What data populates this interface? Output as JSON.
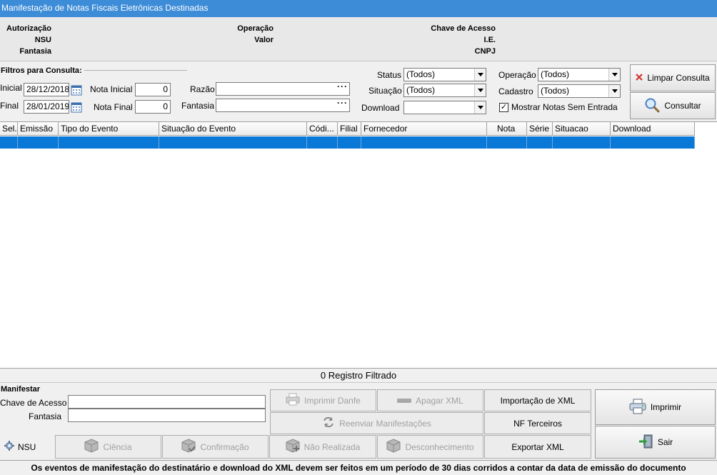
{
  "window": {
    "title": "Manifestação de Notas Fiscais Eletrônicas Destinadas"
  },
  "info": {
    "autorizacao": "Autorização",
    "nsu": "NSU",
    "fantasia": "Fantasia",
    "operacao": "Operação",
    "valor": "Valor",
    "chave_acesso": "Chave de Acesso",
    "ie": "I.E.",
    "cnpj": "CNPJ"
  },
  "filters": {
    "title": "Filtros para Consulta:",
    "inicial_label": "Inicial",
    "inicial_value": "28/12/2018",
    "final_label": "Final",
    "final_value": "28/01/2019",
    "nota_inicial_label": "Nota Inicial",
    "nota_inicial_value": "0",
    "nota_final_label": "Nota Final",
    "nota_final_value": "0",
    "razao_label": "Razão",
    "razao_value": "",
    "fantasia_label": "Fantasia",
    "fantasia_value": "",
    "status_label": "Status",
    "status_value": "(Todos)",
    "situacao_label": "Situação",
    "situacao_value": "(Todos)",
    "download_label": "Download",
    "download_value": "",
    "operacao_label": "Operação",
    "operacao_value": "(Todos)",
    "cadastro_label": "Cadastro",
    "cadastro_value": "(Todos)",
    "mostrar_notas_label": "Mostrar Notas Sem Entrada",
    "mostrar_notas_checked": "✓",
    "ellipsis": "···",
    "limpar_label": "Limpar Consulta",
    "consultar_label": "Consultar"
  },
  "grid": {
    "columns": [
      "Sel.",
      "Emissão",
      "Tipo do Evento",
      "Situação do Evento",
      "Códi...",
      "Filial",
      "Fornecedor",
      "Nota",
      "Série",
      "Situacao",
      "Download"
    ],
    "selected_row": [
      "",
      "",
      "",
      "",
      "",
      "",
      "",
      "",
      "",
      "",
      ""
    ]
  },
  "status": {
    "registros": "0 Registro Filtrado"
  },
  "manifestar": {
    "title": "Manifestar",
    "chave_acesso_label": "Chave de Acesso",
    "chave_acesso_value": "",
    "fantasia_label": "Fantasia",
    "fantasia_value": "",
    "nsu_label": "NSU",
    "imprimir_danfe": "Imprimir Danfe",
    "apagar_xml": "Apagar XML",
    "importacao_xml": "Importação de XML",
    "imprimir": "Imprimir",
    "reenviar": "Reenviar Manifestações",
    "nf_terceiros": "NF Terceiros",
    "sair": "Sair",
    "ciencia": "Ciência",
    "confirmacao": "Confirmação",
    "nao_realizada": "Não Realizada",
    "desconhecimento": "Desconhecimento",
    "exportar_xml": "Exportar XML"
  },
  "footer": {
    "message": "Os eventos de manifestação do destinatário e download do XML devem ser feitos em um período de 30 dias corridos a contar da data de emissão do documento"
  },
  "colors": {
    "title_bar": "#3c8cd8",
    "selection": "#0a78d7",
    "clear_icon": "#d0302a"
  }
}
